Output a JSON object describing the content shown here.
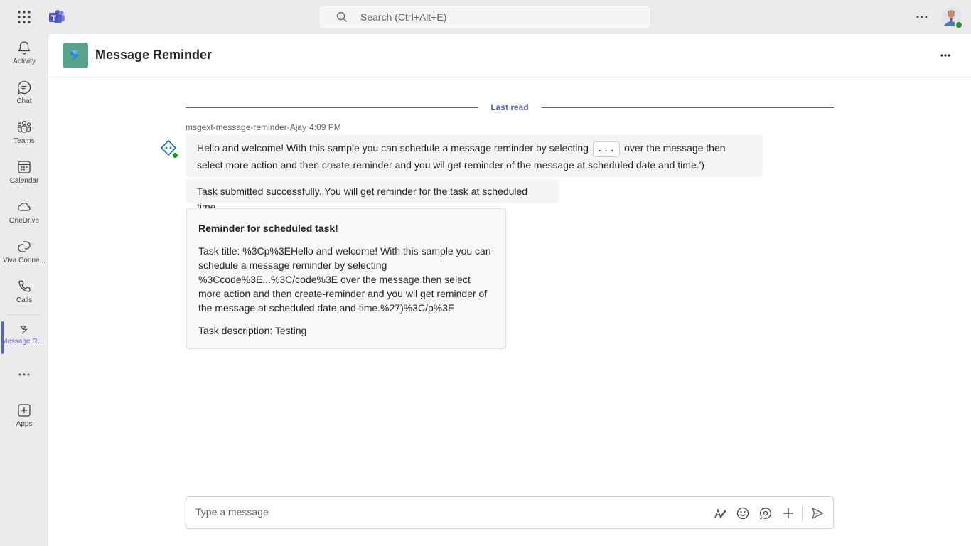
{
  "topbar": {
    "search_placeholder": "Search (Ctrl+Alt+E)"
  },
  "rail": {
    "items": [
      {
        "label": "Activity",
        "icon": "bell-icon"
      },
      {
        "label": "Chat",
        "icon": "chat-icon"
      },
      {
        "label": "Teams",
        "icon": "teams-icon"
      },
      {
        "label": "Calendar",
        "icon": "calendar-icon"
      },
      {
        "label": "OneDrive",
        "icon": "cloud-icon"
      },
      {
        "label": "Viva Conne...",
        "icon": "viva-connections-icon"
      },
      {
        "label": "Calls",
        "icon": "phone-icon"
      },
      {
        "label": "Message Re...",
        "icon": "message-reminder-icon"
      },
      {
        "label": "Apps",
        "icon": "add-app-icon"
      }
    ],
    "active": "Message Re..."
  },
  "header": {
    "title": "Message Reminder"
  },
  "conversation": {
    "last_read_label": "Last read",
    "sender": "msgext-message-reminder-Ajay",
    "time": "4:09 PM",
    "message1": {
      "part1": "Hello and welcome! With this sample you can schedule a message reminder by selecting",
      "code": "...",
      "part2": "over the message then select more action and then create-reminder and you wil get reminder of the message at scheduled date and time.')"
    },
    "message2": "Task submitted successfully. You will get reminder for the task at scheduled time",
    "card": {
      "title": "Reminder for scheduled task!",
      "task_title": "Task title: %3Cp%3EHello and welcome! With this sample you can schedule a message reminder by selecting %3Ccode%3E...%3C/code%3E over the message then select more action and then create-reminder and you wil get reminder of the message at scheduled date and time.%27)%3C/p%3E",
      "task_description": "Task description: Testing"
    }
  },
  "composer": {
    "placeholder": "Type a message"
  },
  "colors": {
    "accent": "#5b5fc7",
    "app_tile": "#59a28b",
    "presence_available": "#13a10e"
  }
}
